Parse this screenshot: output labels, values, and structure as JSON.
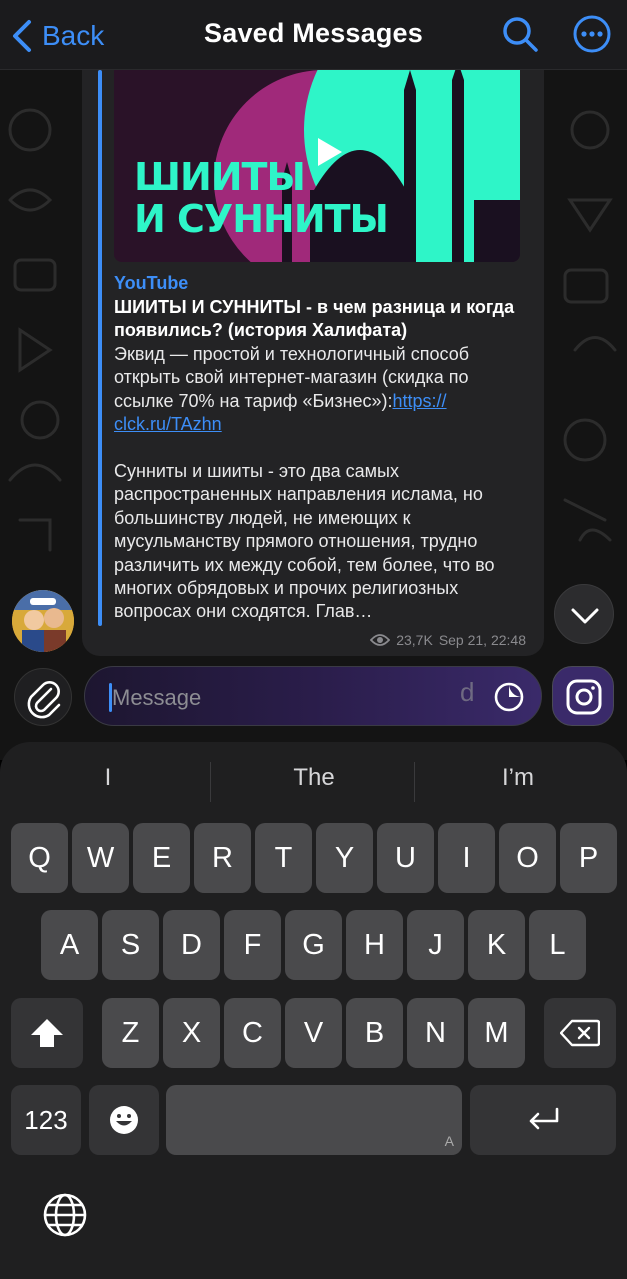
{
  "header": {
    "back_label": "Back",
    "title": "Saved Messages",
    "accent": "#3d8ef7"
  },
  "message": {
    "thumbnail_title": "ШИИТЫ\nИ СУННИТЫ",
    "site": "YouTube",
    "title": "ШИИТЫ И СУННИТЫ - в чем разница и когда появились? (история Халифата)",
    "desc_part1": "Эквид — простой и технологичный способ открыть свой интернет-магазин (скидка по ссылке 70% на тариф «Бизнес»):",
    "link": "https://clck.ru/TAzhn",
    "link_line1": "https://",
    "link_line2": "clck.ru/TAzhn",
    "desc_part2": "Сунниты и шииты - это два самых распространенных направления ислама, но большинству людей, не имеющих к мусульманству прямого отношения, трудно различить их между собой, тем более, что во многих обрядовых и прочих религиозных вопросах они сходятся. Глав…",
    "views": "23,7K",
    "date": "Sep 21, 22:48"
  },
  "input": {
    "placeholder": "Message",
    "ghost_text": "d"
  },
  "keyboard": {
    "suggestions": [
      "I",
      "The",
      "I’m"
    ],
    "row1": [
      "Q",
      "W",
      "E",
      "R",
      "T",
      "Y",
      "U",
      "I",
      "O",
      "P"
    ],
    "row2": [
      "A",
      "S",
      "D",
      "F",
      "G",
      "H",
      "J",
      "K",
      "L"
    ],
    "row3": [
      "Z",
      "X",
      "C",
      "V",
      "B",
      "N",
      "M"
    ],
    "numbers_label": "123",
    "space_hint": "A"
  },
  "icons": [
    "chevron-left-icon",
    "search-icon",
    "more-icon",
    "play-icon",
    "views-icon",
    "chevron-down-icon",
    "paperclip-icon",
    "sticker-icon",
    "camera-icon",
    "shift-icon",
    "backspace-icon",
    "emoji-icon",
    "return-icon",
    "globe-icon"
  ]
}
